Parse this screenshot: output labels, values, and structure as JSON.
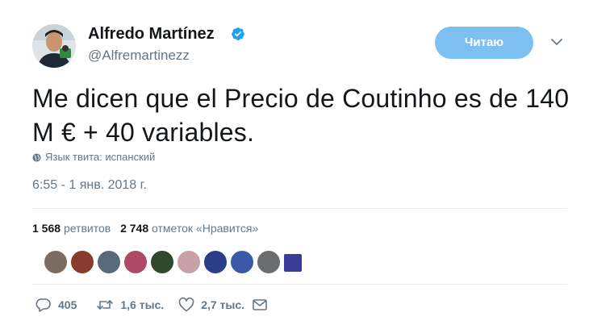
{
  "author": {
    "name": "Alfredo Martínez",
    "handle": "@Alfremartinezz",
    "verified": true
  },
  "follow_button": {
    "label": "Читаю"
  },
  "tweet": {
    "text": "Me dicen que el Precio de Coutinho es de 140 M € + 40 variables.",
    "language_label": "Язык твита: испанский",
    "timestamp": "6:55 - 1 янв. 2018 г."
  },
  "stats": {
    "retweets_count": "1 568",
    "retweets_label": "ретвитов",
    "likes_count": "2 748",
    "likes_label": "отметок «Нравится»"
  },
  "liker_avatar_count": 10,
  "actions": {
    "reply_count": "405",
    "retweet_count": "1,6 тыс.",
    "like_count": "2,7 тыс."
  },
  "colors": {
    "follow_button_bg": "#7bc0f0",
    "verified_badge": "#1da1f2",
    "secondary_text": "#657786",
    "divider": "#e6ecf0"
  },
  "icons": [
    "verified-badge-icon",
    "chevron-down-icon",
    "globe-icon",
    "reply-icon",
    "retweet-icon",
    "like-icon",
    "message-icon"
  ]
}
